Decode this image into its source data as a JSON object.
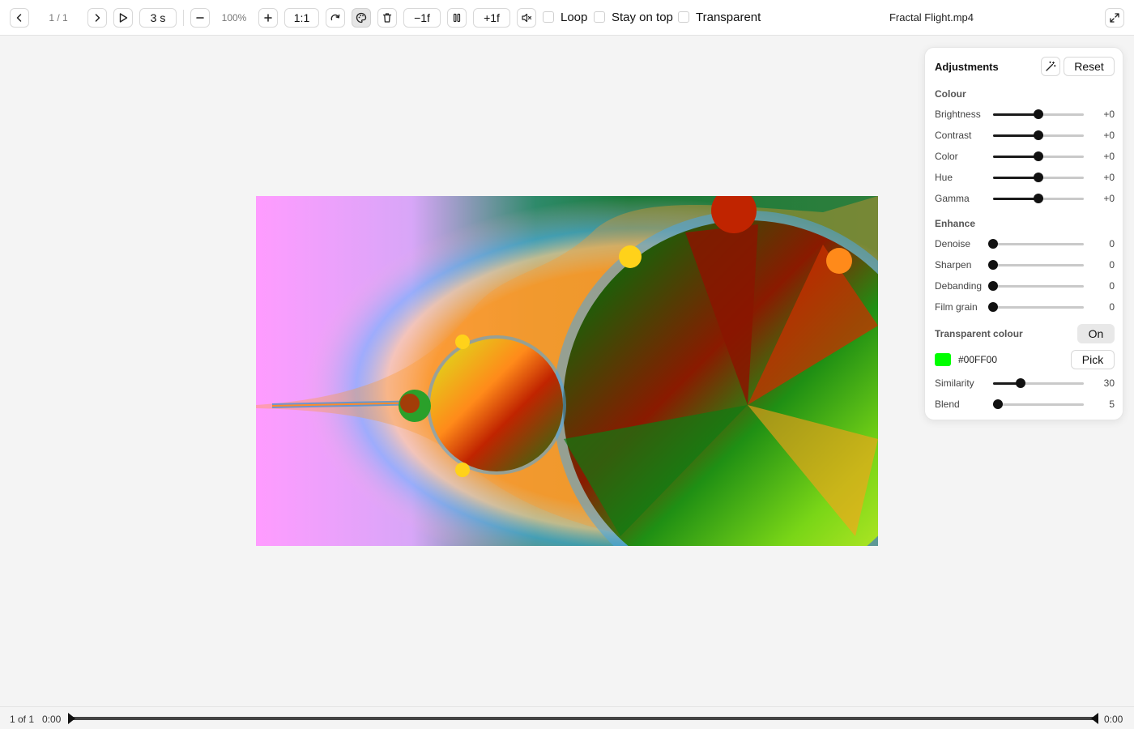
{
  "toolbar": {
    "prev_icon": "chevron-left-icon",
    "counter": "1 / 1",
    "next_icon": "chevron-right-icon",
    "play_icon": "play-icon",
    "interval": "3 s",
    "zoom_out_icon": "minus-icon",
    "zoom": "100%",
    "zoom_in_icon": "plus-icon",
    "actual_size": "1:1",
    "rotate_icon": "rotate-icon",
    "adjust_icon": "palette-icon",
    "delete_icon": "trash-icon",
    "frame_back": "−1f",
    "pause_icon": "pause-icon",
    "frame_forward": "+1f",
    "mute_icon": "speaker-muted-icon",
    "loop_label": "Loop",
    "loop_checked": false,
    "stay_on_top_label": "Stay on top",
    "stay_on_top_checked": false,
    "transparent_label": "Transparent",
    "transparent_checked": false,
    "title": "Fractal Flight.mp4",
    "fullscreen_icon": "expand-icon"
  },
  "adjustments": {
    "title": "Adjustments",
    "auto_icon": "magic-wand-icon",
    "reset_label": "Reset",
    "colour_heading": "Colour",
    "colour": [
      {
        "label": "Brightness",
        "value": "+0",
        "level": 0.5
      },
      {
        "label": "Contrast",
        "value": "+0",
        "level": 0.5
      },
      {
        "label": "Color",
        "value": "+0",
        "level": 0.5
      },
      {
        "label": "Hue",
        "value": "+0",
        "level": 0.5
      },
      {
        "label": "Gamma",
        "value": "+0",
        "level": 0.5
      }
    ],
    "enhance_heading": "Enhance",
    "enhance": [
      {
        "label": "Denoise",
        "value": "0",
        "level": 0
      },
      {
        "label": "Sharpen",
        "value": "0",
        "level": 0
      },
      {
        "label": "Debanding",
        "value": "0",
        "level": 0
      },
      {
        "label": "Film grain",
        "value": "0",
        "level": 0
      }
    ],
    "transparent_colour_label": "Transparent colour",
    "transparent_colour_toggle": "On",
    "transparent_colour_hex": "#00FF00",
    "swatch_color": "#00ff00",
    "pick_label": "Pick",
    "key": [
      {
        "label": "Similarity",
        "value": "30",
        "level": 0.3
      },
      {
        "label": "Blend",
        "value": "5",
        "level": 0.05
      }
    ]
  },
  "timeline": {
    "count": "1 of 1",
    "current_time": "0:00",
    "end_time": "0:00",
    "progress": 0
  }
}
